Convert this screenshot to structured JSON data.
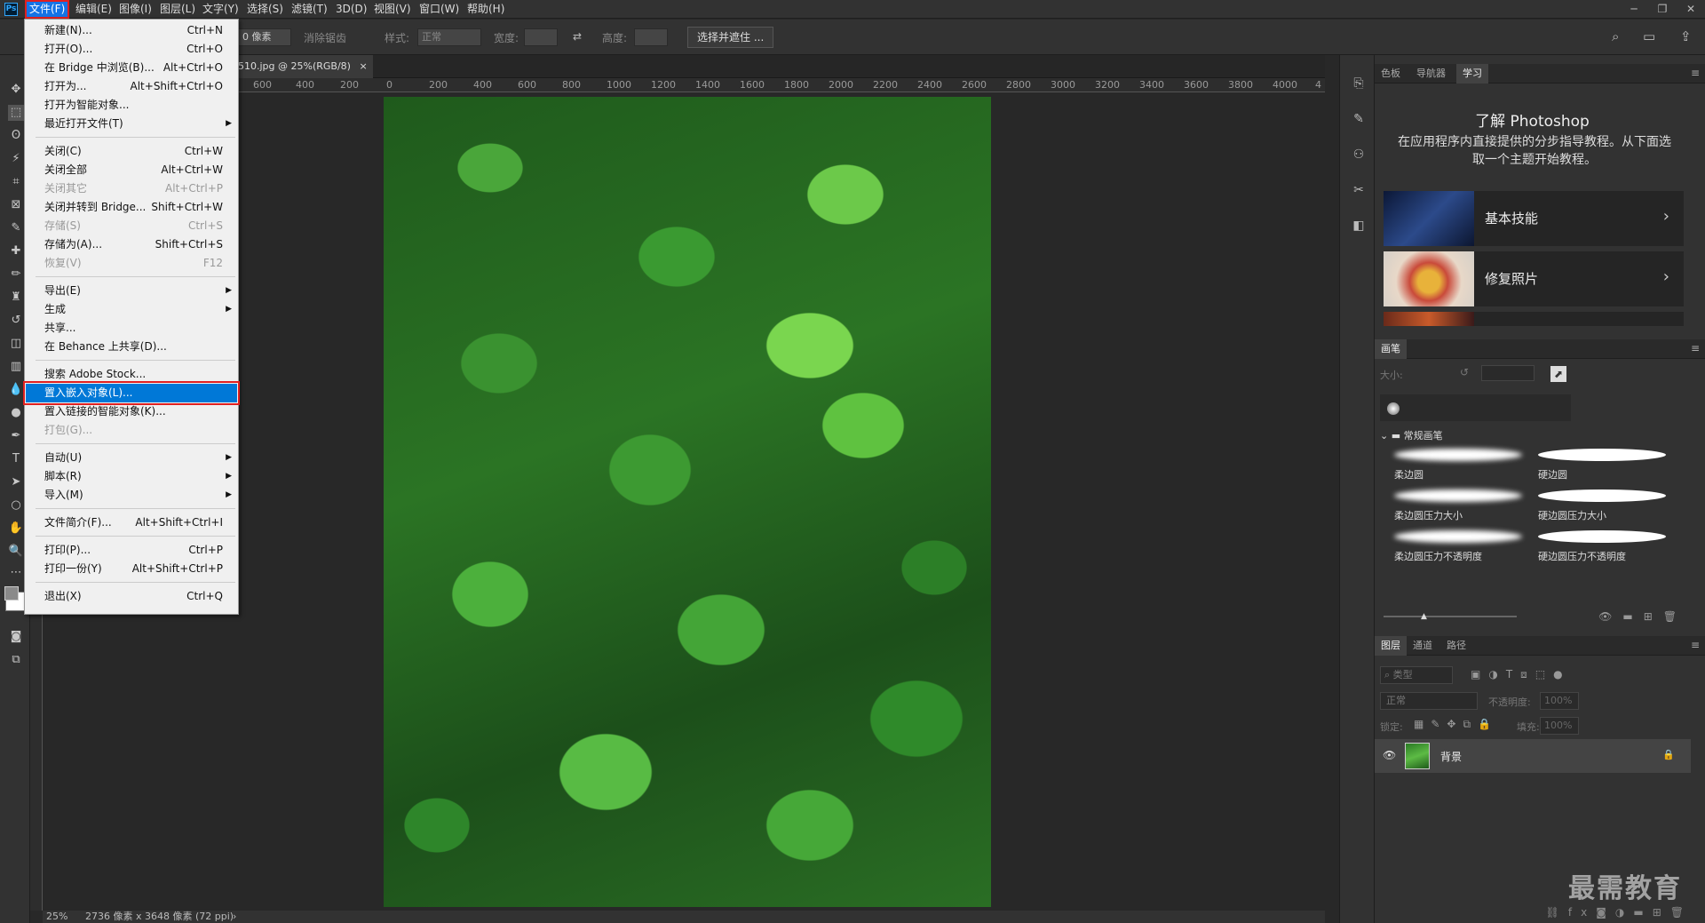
{
  "menubar": {
    "logo": "Ps",
    "items": [
      "文件(F)",
      "编辑(E)",
      "图像(I)",
      "图层(L)",
      "文字(Y)",
      "选择(S)",
      "滤镜(T)",
      "3D(D)",
      "视图(V)",
      "窗口(W)",
      "帮助(H)"
    ]
  },
  "optbar": {
    "feather_value": "0 像素",
    "antialias_label": "消除锯齿",
    "style_label": "样式:",
    "style_value": "正常",
    "width_label": "宽度:",
    "height_label": "高度:",
    "select_mask_button": "选择并遮住 ..."
  },
  "document": {
    "tab_label": "510.jpg @ 25%(RGB/8)",
    "close": "×"
  },
  "ruler": {
    "ticks": [
      "600",
      "400",
      "200",
      "0",
      "200",
      "400",
      "600",
      "800",
      "1000",
      "1200",
      "1400",
      "1600",
      "1800",
      "2000",
      "2200",
      "2400",
      "2600",
      "2800",
      "3000",
      "3200",
      "3400",
      "3600",
      "3800",
      "4000",
      "4"
    ]
  },
  "file_menu": [
    {
      "label": "新建(N)...",
      "shortcut": "Ctrl+N"
    },
    {
      "label": "打开(O)...",
      "shortcut": "Ctrl+O"
    },
    {
      "label": "在 Bridge 中浏览(B)...",
      "shortcut": "Alt+Ctrl+O"
    },
    {
      "label": "打开为...",
      "shortcut": "Alt+Shift+Ctrl+O"
    },
    {
      "label": "打开为智能对象...",
      "shortcut": ""
    },
    {
      "label": "最近打开文件(T)",
      "shortcut": ""
    },
    {
      "label": "关闭(C)",
      "shortcut": "Ctrl+W"
    },
    {
      "label": "关闭全部",
      "shortcut": "Alt+Ctrl+W"
    },
    {
      "label": "关闭其它",
      "shortcut": "Alt+Ctrl+P"
    },
    {
      "label": "关闭并转到 Bridge...",
      "shortcut": "Shift+Ctrl+W"
    },
    {
      "label": "存储(S)",
      "shortcut": "Ctrl+S"
    },
    {
      "label": "存储为(A)...",
      "shortcut": "Shift+Ctrl+S"
    },
    {
      "label": "恢复(V)",
      "shortcut": "F12"
    },
    {
      "label": "导出(E)",
      "shortcut": ""
    },
    {
      "label": "生成",
      "shortcut": ""
    },
    {
      "label": "共享...",
      "shortcut": ""
    },
    {
      "label": "在 Behance 上共享(D)...",
      "shortcut": ""
    },
    {
      "label": "搜索 Adobe Stock...",
      "shortcut": ""
    },
    {
      "label": "置入嵌入对象(L)...",
      "shortcut": ""
    },
    {
      "label": "置入链接的智能对象(K)...",
      "shortcut": ""
    },
    {
      "label": "打包(G)...",
      "shortcut": ""
    },
    {
      "label": "自动(U)",
      "shortcut": ""
    },
    {
      "label": "脚本(R)",
      "shortcut": ""
    },
    {
      "label": "导入(M)",
      "shortcut": ""
    },
    {
      "label": "文件简介(F)...",
      "shortcut": "Alt+Shift+Ctrl+I"
    },
    {
      "label": "打印(P)...",
      "shortcut": "Ctrl+P"
    },
    {
      "label": "打印一份(Y)",
      "shortcut": "Alt+Shift+Ctrl+P"
    },
    {
      "label": "退出(X)",
      "shortcut": "Ctrl+Q"
    }
  ],
  "status": {
    "zoom": "25%",
    "doc_info": "2736 像素 x 3648 像素 (72 ppi)",
    "arrow": "›"
  },
  "learn_panel": {
    "tabs": [
      "色板",
      "导航器",
      "学习"
    ],
    "title": "了解 Photoshop",
    "desc": "在应用程序内直接提供的分步指导教程。从下面选取一个主题开始教程。",
    "cards": [
      "基本技能",
      "修复照片"
    ]
  },
  "brush_panel": {
    "tab": "画笔",
    "size_label": "大小:",
    "folder": "常规画笔",
    "brushes": [
      "柔边圆",
      "硬边圆",
      "柔边圆压力大小",
      "硬边圆压力大小",
      "柔边圆压力不透明度",
      "硬边圆压力不透明度"
    ]
  },
  "layers_panel": {
    "tabs": [
      "图层",
      "通道",
      "路径"
    ],
    "filter_placeholder": "类型",
    "blend_mode": "正常",
    "opacity_label": "不透明度:",
    "opacity_value": "100%",
    "lock_label": "锁定:",
    "fill_label": "填充:",
    "fill_value": "100%",
    "layer_name": "背景"
  },
  "watermark": "最需教育"
}
